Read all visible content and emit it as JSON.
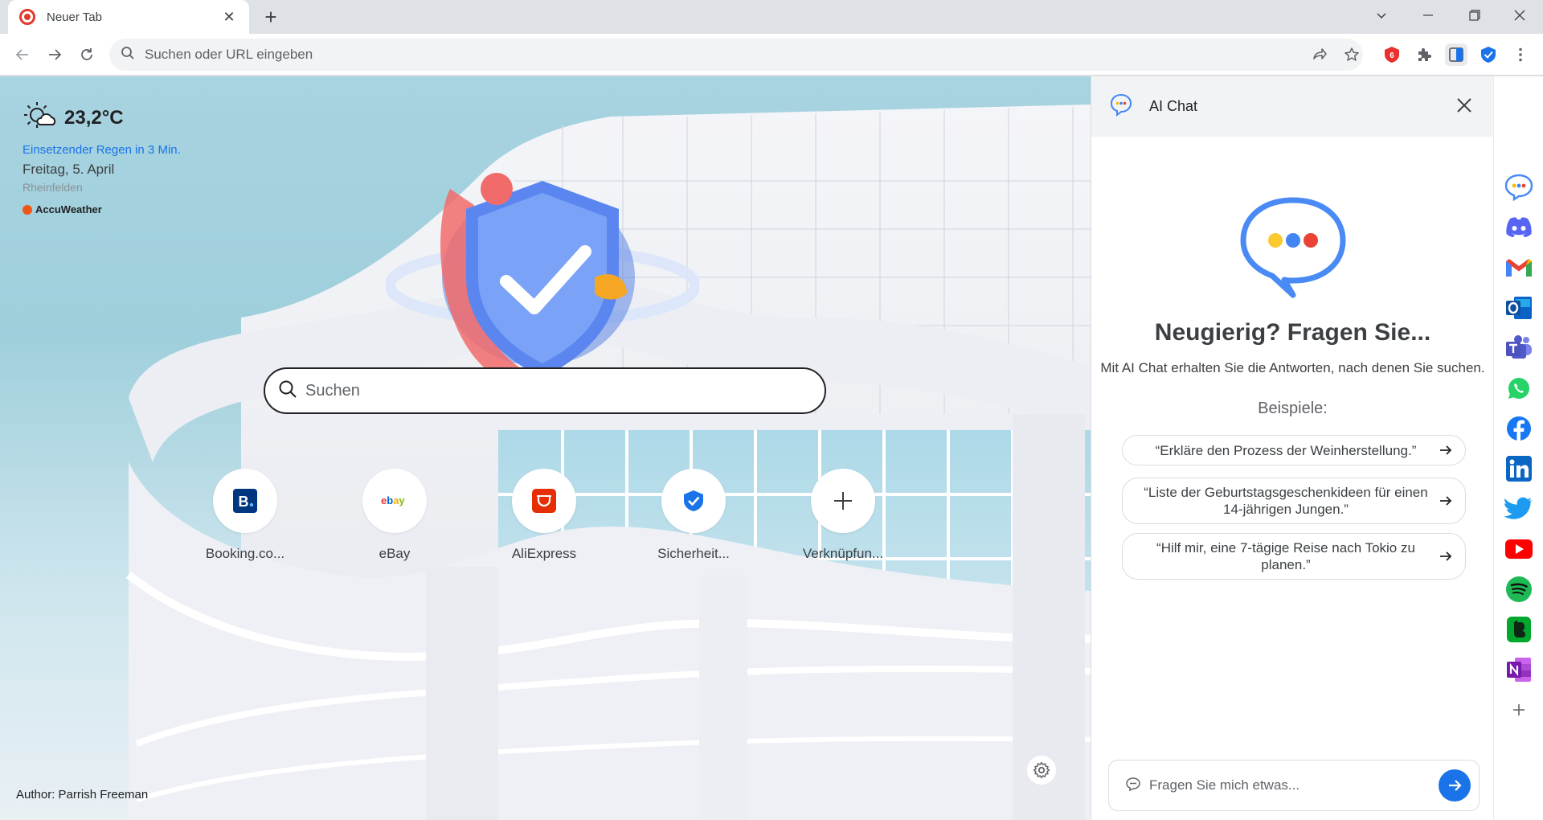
{
  "browser": {
    "tab": {
      "title": "Neuer Tab",
      "close_glyph": "✕"
    },
    "new_tab_glyph": "+",
    "window_controls": [
      "chevron-down-icon",
      "minimize-icon",
      "restore-icon",
      "close-icon"
    ],
    "omnibox": {
      "placeholder": "Suchen oder URL eingeben"
    },
    "toolbar_icons": [
      "back-icon",
      "forward-icon",
      "reload-icon",
      "share-icon",
      "star-icon"
    ],
    "extensions": [
      "adblock-icon",
      "puzzle-icon",
      "sidebar-icon",
      "shield-check-icon",
      "more-vert-icon"
    ]
  },
  "ntp": {
    "weather": {
      "temperature": "23,2°C",
      "alert": "Einsetzender Regen in 3 Min.",
      "date": "Freitag, 5. April",
      "location": "Rheinfelden",
      "provider": "AccuWeather"
    },
    "search": {
      "placeholder": "Suchen"
    },
    "shortcuts": [
      {
        "label": "Booking.co...",
        "icon": "booking-icon"
      },
      {
        "label": "eBay",
        "icon": "ebay-icon"
      },
      {
        "label": "AliExpress",
        "icon": "aliexpress-icon"
      },
      {
        "label": "Sicherheit...",
        "icon": "shield-icon"
      },
      {
        "label": "Verknüpfun...",
        "icon": "plus-icon"
      }
    ],
    "author": "Author: Parrish Freeman",
    "colors": {
      "sky": "#9fcfdc",
      "accent": "#1a73e8"
    }
  },
  "chat": {
    "title": "AI Chat",
    "heading": "Neugierig? Fragen Sie...",
    "subtitle": "Mit AI Chat erhalten Sie die Antworten, nach denen Sie suchen.",
    "examples_label": "Beispiele:",
    "examples": [
      "“Erkläre den Prozess der Weinherstellung.”",
      "“Liste der Geburtstagsgeschenkideen für einen 14-jährigen Jungen.”",
      "“Hilf mir, eine 7-tägige Reise nach Tokio zu planen.”"
    ],
    "input_placeholder": "Fragen Sie mich etwas...",
    "bubble_dot_colors": [
      "#fbbc04",
      "#4285f4",
      "#ea4335"
    ]
  },
  "sidebar": {
    "items": [
      "ai-chat-icon",
      "discord-icon",
      "gmail-icon",
      "outlook-icon",
      "teams-icon",
      "whatsapp-icon",
      "facebook-icon",
      "linkedin-icon",
      "twitter-icon",
      "youtube-icon",
      "spotify-icon",
      "evernote-icon",
      "onenote-icon",
      "add-icon"
    ]
  }
}
